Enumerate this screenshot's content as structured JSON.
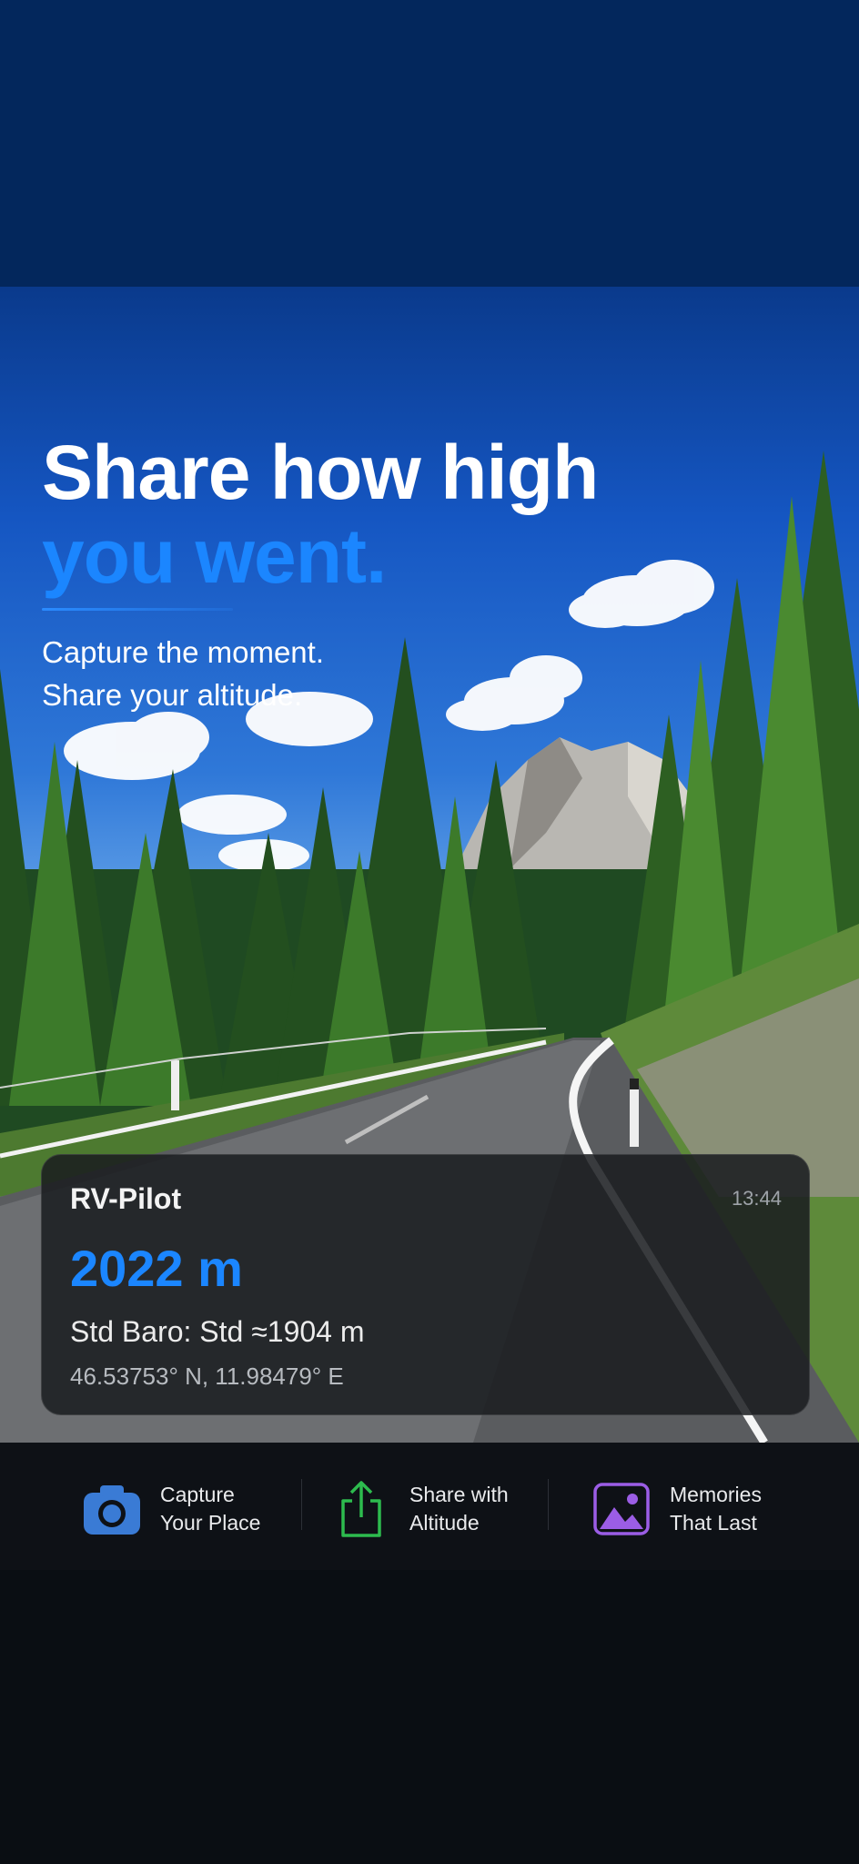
{
  "headline": {
    "line1": "Share how high",
    "line2": "you went."
  },
  "subtitle": {
    "line1": "Capture the moment.",
    "line2": "Share your altitude."
  },
  "card": {
    "title": "RV-Pilot",
    "time": "13:44",
    "altitude": "2022 m",
    "baro": "Std Baro: Std ≈1904 m",
    "coordinates": "46.53753° N, 11.98479° E"
  },
  "features": [
    {
      "icon": "camera-icon",
      "line1": "Capture",
      "line2": "Your Place",
      "color": "#3a7bd5"
    },
    {
      "icon": "share-icon",
      "line1": "Share with",
      "line2": "Altitude",
      "color": "#2dbb4e"
    },
    {
      "icon": "photo-icon",
      "line1": "Memories",
      "line2": "That Last",
      "color": "#9b5de5"
    }
  ],
  "colors": {
    "accent": "#1b86ff",
    "top_band": "#03275c",
    "background": "#0a0e13"
  }
}
